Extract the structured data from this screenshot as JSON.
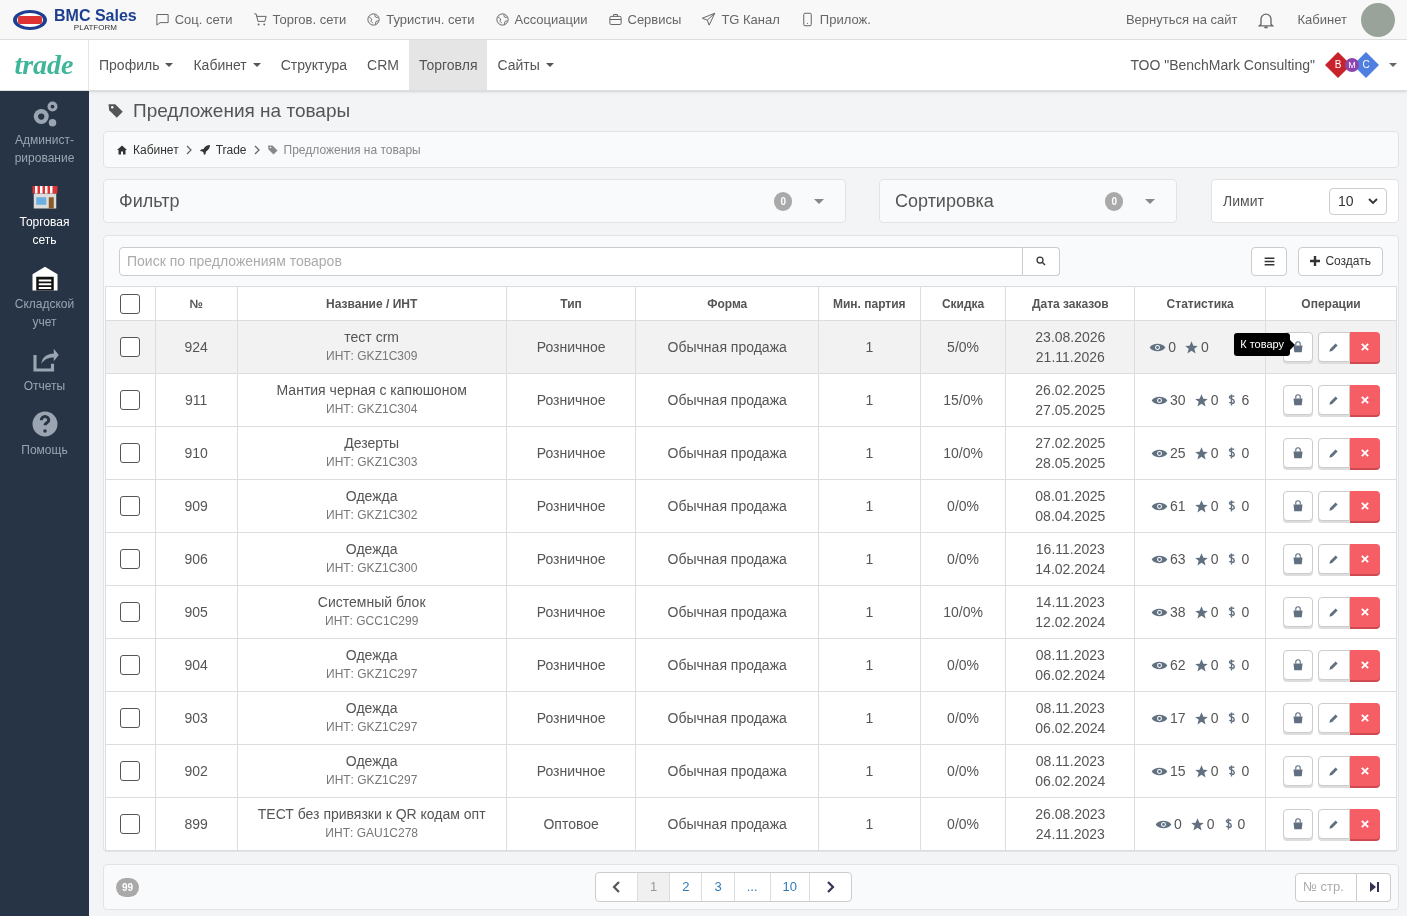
{
  "topbar": {
    "brand": "BMC Sales",
    "brand_sub": "PLATFORM",
    "links": [
      "Соц. сети",
      "Торгов. сети",
      "Туристич. сети",
      "Ассоциации",
      "Сервисы",
      "TG Канал",
      "Прилож."
    ],
    "right_link": "Вернуться на сайт",
    "account": "Кабинет"
  },
  "navbar": {
    "logo": "trade",
    "items": [
      {
        "label": "Профиль",
        "dropdown": true,
        "selected": false
      },
      {
        "label": "Кабинет",
        "dropdown": true,
        "selected": false
      },
      {
        "label": "Структура",
        "dropdown": false,
        "selected": false
      },
      {
        "label": "CRM",
        "dropdown": false,
        "selected": false
      },
      {
        "label": "Торговля",
        "dropdown": false,
        "selected": true
      },
      {
        "label": "Сайты",
        "dropdown": true,
        "selected": false
      }
    ],
    "company": "ТОО \"BenchMark Consulting\"",
    "company_logo": [
      "B",
      "M",
      "C"
    ]
  },
  "sidebar": {
    "items": [
      {
        "label": "Админист-рирование",
        "selected": false
      },
      {
        "label": "Торговая сеть",
        "selected": true
      },
      {
        "label": "Складской учет",
        "selected": false
      },
      {
        "label": "Отчеты",
        "selected": false
      },
      {
        "label": "Помощь",
        "selected": false
      }
    ]
  },
  "page_title": "Предложения на товары",
  "breadcrumbs": [
    "Кабинет",
    "Trade",
    "Предложения на товары"
  ],
  "filter": {
    "title": "Фильтр",
    "count": "0"
  },
  "sort": {
    "title": "Сортировка",
    "count": "0"
  },
  "limit": {
    "label": "Лимит",
    "value": "10"
  },
  "search": {
    "placeholder": "Поиск по предложениям товаров"
  },
  "create_button": "Создать",
  "table": {
    "select_all_checked": false,
    "columns": [
      "№",
      "Название / ИНТ",
      "Тип",
      "Форма",
      "Мин. партия",
      "Скидка",
      "Дата заказов",
      "Статистика",
      "Операции"
    ],
    "rows": [
      {
        "checked": false,
        "highlighted": true,
        "id": "924",
        "name": "тест crm",
        "code": "ИНТ: GKZ1C309",
        "type": "Розничное",
        "form": "Обычная продажа",
        "min": "1",
        "discount": "5/0%",
        "dates": [
          "23.08.2026",
          "21.11.2026"
        ],
        "stats": [
          {
            "kind": "views",
            "value": "0"
          },
          {
            "kind": "stars",
            "value": "0"
          }
        ],
        "tooltip": "К товару"
      },
      {
        "checked": false,
        "highlighted": false,
        "id": "911",
        "name": "Мантия черная с капюшоном",
        "code": "ИНТ: GKZ1C304",
        "type": "Розничное",
        "form": "Обычная продажа",
        "min": "1",
        "discount": "15/0%",
        "dates": [
          "26.02.2025",
          "27.05.2025"
        ],
        "stats": [
          {
            "kind": "views",
            "value": "30"
          },
          {
            "kind": "stars",
            "value": "0"
          },
          {
            "kind": "money",
            "value": "6"
          }
        ]
      },
      {
        "checked": false,
        "highlighted": false,
        "id": "910",
        "name": "Дезерты",
        "code": "ИНТ: GKZ1C303",
        "type": "Розничное",
        "form": "Обычная продажа",
        "min": "1",
        "discount": "10/0%",
        "dates": [
          "27.02.2025",
          "28.05.2025"
        ],
        "stats": [
          {
            "kind": "views",
            "value": "25"
          },
          {
            "kind": "stars",
            "value": "0"
          },
          {
            "kind": "money",
            "value": "0"
          }
        ]
      },
      {
        "checked": false,
        "highlighted": false,
        "id": "909",
        "name": "Одежда",
        "code": "ИНТ: GKZ1C302",
        "type": "Розничное",
        "form": "Обычная продажа",
        "min": "1",
        "discount": "0/0%",
        "dates": [
          "08.01.2025",
          "08.04.2025"
        ],
        "stats": [
          {
            "kind": "views",
            "value": "61"
          },
          {
            "kind": "stars",
            "value": "0"
          },
          {
            "kind": "money",
            "value": "0"
          }
        ]
      },
      {
        "checked": false,
        "highlighted": false,
        "id": "906",
        "name": "Одежда",
        "code": "ИНТ: GKZ1C300",
        "type": "Розничное",
        "form": "Обычная продажа",
        "min": "1",
        "discount": "0/0%",
        "dates": [
          "16.11.2023",
          "14.02.2024"
        ],
        "stats": [
          {
            "kind": "views",
            "value": "63"
          },
          {
            "kind": "stars",
            "value": "0"
          },
          {
            "kind": "money",
            "value": "0"
          }
        ]
      },
      {
        "checked": false,
        "highlighted": false,
        "id": "905",
        "name": "Системный блок",
        "code": "ИНТ: GCC1C299",
        "type": "Розничное",
        "form": "Обычная продажа",
        "min": "1",
        "discount": "10/0%",
        "dates": [
          "14.11.2023",
          "12.02.2024"
        ],
        "stats": [
          {
            "kind": "views",
            "value": "38"
          },
          {
            "kind": "stars",
            "value": "0"
          },
          {
            "kind": "money",
            "value": "0"
          }
        ]
      },
      {
        "checked": false,
        "highlighted": false,
        "id": "904",
        "name": "Одежда",
        "code": "ИНТ: GKZ1C297",
        "type": "Розничное",
        "form": "Обычная продажа",
        "min": "1",
        "discount": "0/0%",
        "dates": [
          "08.11.2023",
          "06.02.2024"
        ],
        "stats": [
          {
            "kind": "views",
            "value": "62"
          },
          {
            "kind": "stars",
            "value": "0"
          },
          {
            "kind": "money",
            "value": "0"
          }
        ]
      },
      {
        "checked": false,
        "highlighted": false,
        "id": "903",
        "name": "Одежда",
        "code": "ИНТ: GKZ1C297",
        "type": "Розничное",
        "form": "Обычная продажа",
        "min": "1",
        "discount": "0/0%",
        "dates": [
          "08.11.2023",
          "06.02.2024"
        ],
        "stats": [
          {
            "kind": "views",
            "value": "17"
          },
          {
            "kind": "stars",
            "value": "0"
          },
          {
            "kind": "money",
            "value": "0"
          }
        ]
      },
      {
        "checked": false,
        "highlighted": false,
        "id": "902",
        "name": "Одежда",
        "code": "ИНТ: GKZ1C297",
        "type": "Розничное",
        "form": "Обычная продажа",
        "min": "1",
        "discount": "0/0%",
        "dates": [
          "08.11.2023",
          "06.02.2024"
        ],
        "stats": [
          {
            "kind": "views",
            "value": "15"
          },
          {
            "kind": "stars",
            "value": "0"
          },
          {
            "kind": "money",
            "value": "0"
          }
        ]
      },
      {
        "checked": false,
        "highlighted": false,
        "id": "899",
        "name": "ТЕСТ без привязки к QR кодам опт",
        "code": "ИНТ: GAU1C278",
        "type": "Оптовое",
        "form": "Обычная продажа",
        "min": "1",
        "discount": "0/0%",
        "dates": [
          "26.08.2023",
          "24.11.2023"
        ],
        "stats": [
          {
            "kind": "views",
            "value": "0"
          },
          {
            "kind": "stars",
            "value": "0"
          },
          {
            "kind": "money",
            "value": "0"
          }
        ]
      }
    ]
  },
  "pagination": {
    "total": "99",
    "pages": [
      {
        "label": "1",
        "selected": true
      },
      {
        "label": "2",
        "selected": false
      },
      {
        "label": "3",
        "selected": false
      },
      {
        "label": "...",
        "selected": false
      },
      {
        "label": "10",
        "selected": false
      }
    ],
    "page_placeholder": "№ стр."
  }
}
